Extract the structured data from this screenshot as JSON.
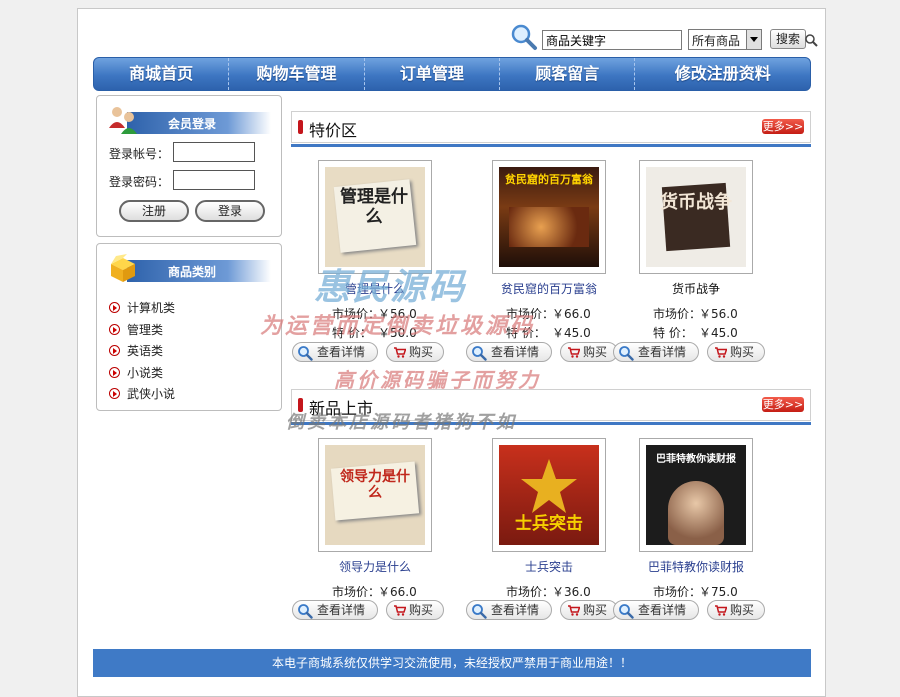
{
  "search": {
    "input_value": "商品关键字",
    "category_selected": "所有商品",
    "button_label": "搜索"
  },
  "nav": {
    "items": [
      "商城首页",
      "购物车管理",
      "订单管理",
      "顾客留言",
      "修改注册资料"
    ]
  },
  "login": {
    "title": "会员登录",
    "account_label": "登录帐号：",
    "password_label": "登录密码：",
    "register_label": "注册",
    "login_label": "登录"
  },
  "categories": {
    "title": "商品类别",
    "items": [
      "计算机类",
      "管理类",
      "英语类",
      "小说类",
      "武侠小说"
    ]
  },
  "special": {
    "title": "特价区",
    "more_label": "更多>>",
    "products": [
      {
        "name": "管理是什么",
        "market_price": "￥56.0",
        "special_price": "￥50.0",
        "cover_text": "管理是什么"
      },
      {
        "name": "贫民窟的百万富翁",
        "market_price": "￥66.0",
        "special_price": "￥45.0",
        "cover_text": "贫民窟的百万富翁"
      },
      {
        "name": "货币战争",
        "market_price": "￥56.0",
        "special_price": "￥45.0",
        "cover_text": "货币战争"
      }
    ]
  },
  "new_arrivals": {
    "title": "新品上市",
    "more_label": "更多>>",
    "products": [
      {
        "name": "领导力是什么",
        "market_price": "￥66.0",
        "cover_text": "领导力是什么"
      },
      {
        "name": "士兵突击",
        "market_price": "￥36.0",
        "cover_text": "士兵突击"
      },
      {
        "name": "巴菲特教你读财报",
        "market_price": "￥75.0",
        "cover_text": "巴菲特教你读财报"
      }
    ]
  },
  "labels": {
    "market_price": "市场价：",
    "special_price": "特  价：",
    "detail": "查看详情",
    "buy": "购买"
  },
  "footer": {
    "text": "本电子商城系统仅供学习交流使用，未经授权严禁用于商业用途！！"
  },
  "watermarks": [
    "惠民源码",
    "为运营而定倒卖垃圾源码",
    "高价源码骗子而努力",
    "倒卖本店源码者猪狗不如"
  ],
  "colors": {
    "nav_blue": "#3d76c2",
    "footer_blue": "#3f7ac6",
    "accent_red": "#c4161c",
    "link_blue": "#2a3f8f"
  }
}
